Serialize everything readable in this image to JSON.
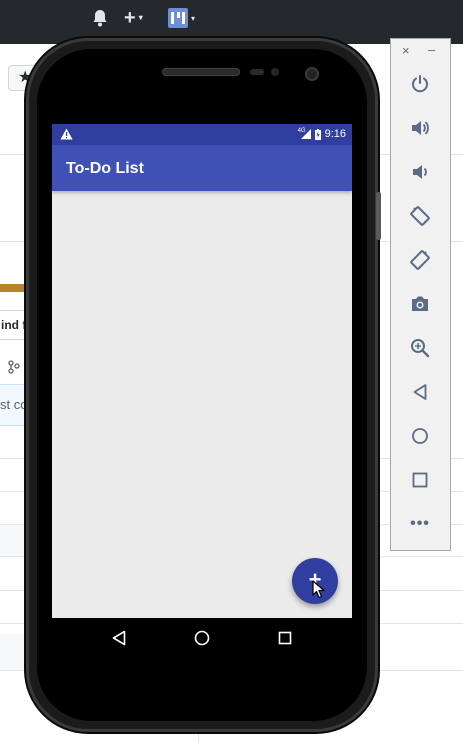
{
  "browser": {
    "topbar": {
      "icons": [
        "bell-icon",
        "plus-icon",
        "avatar-icon"
      ],
      "plus_label": "+",
      "caret": "▾"
    },
    "find_label": "ind f",
    "commit_label": "st co",
    "colors": {
      "topbar": "#24292e",
      "accent": "#b8862a"
    }
  },
  "emulator": {
    "status_bar": {
      "network_label": "4G",
      "time": "9:16"
    },
    "app": {
      "title": "To-Do List",
      "fab_label": "+"
    },
    "nav_buttons": [
      "back-icon",
      "home-icon",
      "recents-icon"
    ],
    "colors": {
      "primary": "#3f51b5",
      "primary_dark": "#303f9f",
      "background": "#ebebeb"
    }
  },
  "toolbar": {
    "close_label": "×",
    "minimize_label": "–",
    "buttons": [
      {
        "name": "power-icon"
      },
      {
        "name": "volume-up-icon"
      },
      {
        "name": "volume-down-icon"
      },
      {
        "name": "rotate-left-icon"
      },
      {
        "name": "rotate-right-icon"
      },
      {
        "name": "camera-icon"
      },
      {
        "name": "zoom-icon"
      },
      {
        "name": "back-icon"
      },
      {
        "name": "home-icon"
      },
      {
        "name": "overview-icon"
      }
    ],
    "more_label": "•••",
    "icon_color": "#5a6b86"
  }
}
